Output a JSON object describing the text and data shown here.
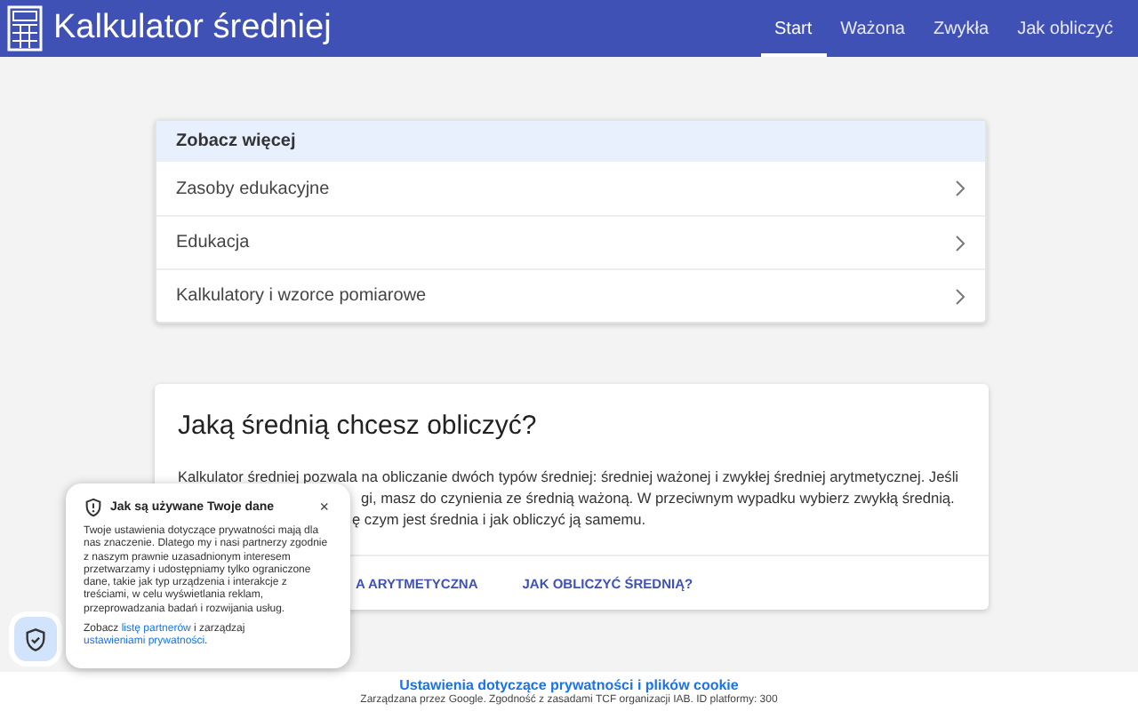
{
  "header": {
    "title": "Kalkulator średniej",
    "nav": [
      {
        "label": "Start",
        "selected": true
      },
      {
        "label": "Ważona",
        "selected": false
      },
      {
        "label": "Zwykła",
        "selected": false
      },
      {
        "label": "Jak obliczyć",
        "selected": false
      }
    ]
  },
  "more": {
    "heading": "Zobacz więcej",
    "items": [
      "Zasoby edukacyjne",
      "Edukacja",
      "Kalkulatory i wzorce pomiarowe"
    ]
  },
  "intro": {
    "title": "Jaką średnią chcesz obliczyć?",
    "lines": [
      "Kalkulator średniej pozwala na obliczanie dwóch typów średniej: średniej ważonej i zwykłej średniej arytmetycznej. Jeśli",
      "gi, masz do czynienia ze średnią ważoną. W przeciwnym wypadku wybierz zwykłą średnią.",
      "ę czym jest średnia i jak obliczyć ją samemu."
    ],
    "actions": [
      "A ARYTMETYCZNA",
      "JAK OBLICZYĆ ŚREDNIĄ?"
    ]
  },
  "privacy_popup": {
    "title": "Jak są używane Twoje dane",
    "close": "×",
    "body": "Twoje ustawienia dotyczące prywatności mają dla nas znaczenie. Dlatego my i nasi partnerzy zgodnie z naszym prawnie uzasadnionym interesem przetwarzamy i udostępniamy tylko ograniczone dane, takie jak typ urządzenia i interakcje z treściami, w celu wyświetlania reklam, przeprowadzania badań i rozwijania usług.",
    "see_prefix": "Zobacz",
    "partners_link": "listę partnerów",
    "middle": "i zarządzaj",
    "settings_link": "ustawieniami prywatności",
    "end": "."
  },
  "footer": {
    "link": "Ustawienia dotyczące prywatności i plików cookie",
    "note": "Zarządzana przez Google. Zgodność z zasadami TCF organizacji IAB. ID platformy: 300"
  }
}
